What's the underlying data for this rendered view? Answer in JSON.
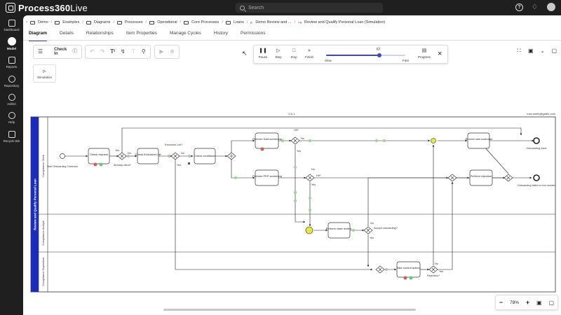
{
  "app": {
    "name_bold": "Process360",
    "name_light": "Live"
  },
  "search": {
    "placeholder": "Search"
  },
  "nav": [
    {
      "label": "Dashboard",
      "icon": "dashboard-icon"
    },
    {
      "label": "Model",
      "icon": "model-icon",
      "active": true
    },
    {
      "label": "Reports",
      "icon": "reports-icon"
    },
    {
      "label": "Repository",
      "icon": "repository-icon"
    },
    {
      "label": "Admin",
      "icon": "admin-icon"
    },
    {
      "label": "Help",
      "icon": "help-icon"
    },
    {
      "label": "Recycle Bin",
      "icon": "recycle-bin-icon"
    }
  ],
  "breadcrumb": [
    "Demo",
    "Examples",
    "Diagrams",
    "Processes",
    "Operational",
    "Core Processes",
    "Loans",
    "Demo Review and ...",
    "Review and Qualify Personal Loan (Simulation)"
  ],
  "tabs": [
    "Diagram",
    "Details",
    "Relationships",
    "Item Properties",
    "Manage Cycles",
    "History",
    "Permissions"
  ],
  "toolbar": {
    "check_in": "Check In",
    "simulation": "Simulation"
  },
  "sim": {
    "pause": "Pause",
    "step": "Step",
    "stop": "Stop",
    "finish": "Finish",
    "speed_value": "67",
    "speed_fraction": 0.67,
    "slow": "Slow",
    "fast": "Fast",
    "progress": "Progress"
  },
  "zoom": {
    "level": "78%"
  },
  "diagram": {
    "version": "0.0.1",
    "author": "max.smith@grafix.com",
    "pool": "Review and Qualify Personal Loan",
    "lanes": [
      "Compliance Clerk",
      "Compliance Analyst",
      "Compliance Supervisor"
    ],
    "start": "Start Onboarding Customer",
    "tasks": {
      "check_request": "Check request",
      "check_exclusion": "Check Exclusion List",
      "check_conditions": "Check conditions",
      "sanctions": "Perform S&A screening",
      "pep": "Perform PEP screening",
      "record": "Record new customer",
      "rejection": "Perform rejection",
      "case_review": "Perform case review",
      "control": "Take control action"
    },
    "labels": {
      "yes": "Yes",
      "no": "No",
      "client": "Already client?",
      "exclusion": "Exclusion List?",
      "hit1": "Hit?",
      "hit2": "Hit?",
      "accept": "Accept onboarding?",
      "rejection_q": "Rejection?",
      "done": "Onboarding done",
      "failed": "Onboarding failed or not needed"
    }
  }
}
